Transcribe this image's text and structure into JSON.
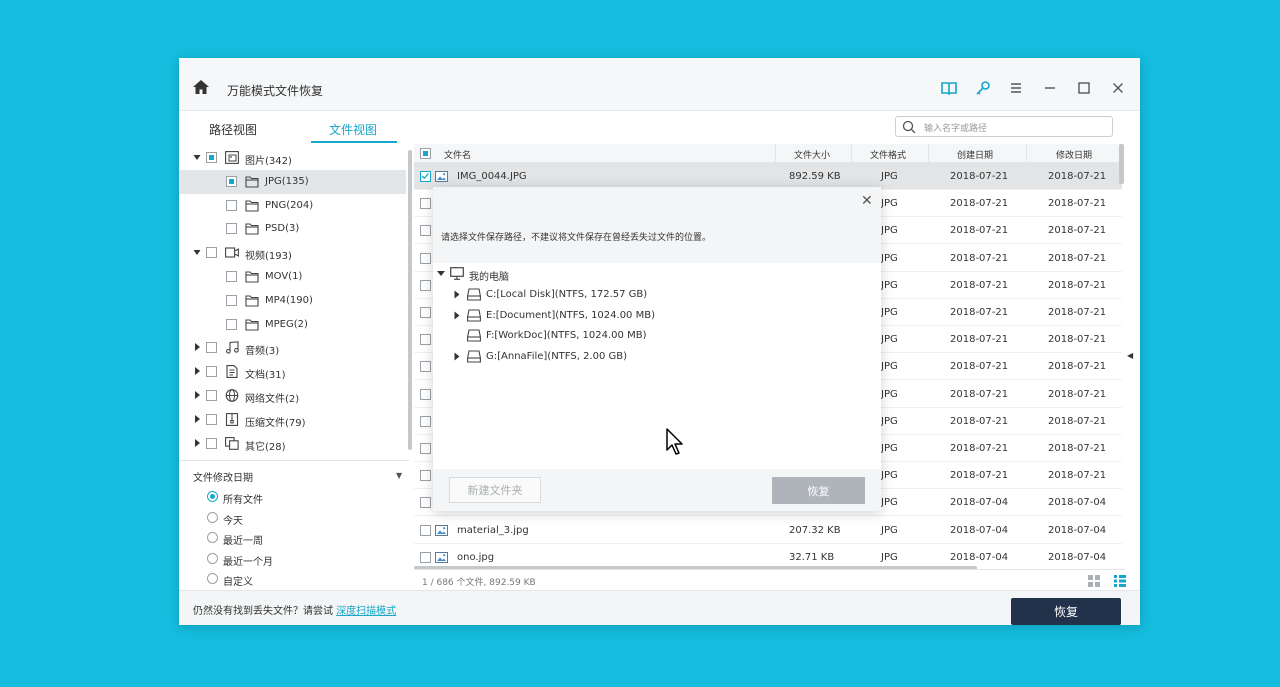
{
  "window": {
    "title": "万能模式文件恢复"
  },
  "tabs": [
    {
      "label": "路径视图",
      "active": false
    },
    {
      "label": "文件视图",
      "active": true
    }
  ],
  "search": {
    "placeholder": "输入名字或路径"
  },
  "tree": [
    {
      "label": "图片(342)",
      "icon": "image-folder-icon",
      "expanded": true,
      "check": "partial"
    },
    {
      "label": "JPG(135)",
      "icon": "folder-icon",
      "child": true,
      "check": "partial",
      "selected": true
    },
    {
      "label": "PNG(204)",
      "icon": "folder-icon",
      "child": true,
      "check": "none"
    },
    {
      "label": "PSD(3)",
      "icon": "folder-icon",
      "child": true,
      "check": "none"
    },
    {
      "label": "视频(193)",
      "icon": "video-folder-icon",
      "expanded": true,
      "check": "none"
    },
    {
      "label": "MOV(1)",
      "icon": "folder-icon",
      "child": true,
      "check": "none"
    },
    {
      "label": "MP4(190)",
      "icon": "folder-icon",
      "child": true,
      "check": "none"
    },
    {
      "label": "MPEG(2)",
      "icon": "folder-icon",
      "child": true,
      "check": "none"
    },
    {
      "label": "音频(3)",
      "icon": "music-icon",
      "expanded": false,
      "check": "none"
    },
    {
      "label": "文档(31)",
      "icon": "document-icon",
      "expanded": false,
      "check": "none"
    },
    {
      "label": "网络文件(2)",
      "icon": "globe-icon",
      "expanded": false,
      "check": "none"
    },
    {
      "label": "压缩文件(79)",
      "icon": "archive-icon",
      "expanded": false,
      "check": "none"
    },
    {
      "label": "其它(28)",
      "icon": "copy-icon",
      "expanded": false,
      "check": "none"
    }
  ],
  "filter": {
    "title": "文件修改日期",
    "options": [
      {
        "label": "所有文件",
        "selected": true
      },
      {
        "label": "今天",
        "selected": false
      },
      {
        "label": "最近一周",
        "selected": false
      },
      {
        "label": "最近一个月",
        "selected": false
      },
      {
        "label": "自定义",
        "selected": false
      }
    ]
  },
  "list": {
    "headers": {
      "name": "文件名",
      "size": "文件大小",
      "format": "文件格式",
      "created": "创建日期",
      "modified": "修改日期"
    },
    "rows": [
      {
        "name": "IMG_0044.JPG",
        "size": "892.59 KB",
        "format": "JPG",
        "created": "2018-07-21",
        "modified": "2018-07-21",
        "selected": true,
        "checked": true
      },
      {
        "name": "",
        "size": "",
        "format": "JPG",
        "created": "2018-07-21",
        "modified": "2018-07-21"
      },
      {
        "name": "",
        "size": "",
        "format": "JPG",
        "created": "2018-07-21",
        "modified": "2018-07-21"
      },
      {
        "name": "",
        "size": "",
        "format": "JPG",
        "created": "2018-07-21",
        "modified": "2018-07-21"
      },
      {
        "name": "",
        "size": "",
        "format": "JPG",
        "created": "2018-07-21",
        "modified": "2018-07-21"
      },
      {
        "name": "",
        "size": "",
        "format": "JPG",
        "created": "2018-07-21",
        "modified": "2018-07-21"
      },
      {
        "name": "",
        "size": "",
        "format": "JPG",
        "created": "2018-07-21",
        "modified": "2018-07-21"
      },
      {
        "name": "",
        "size": "",
        "format": "JPG",
        "created": "2018-07-21",
        "modified": "2018-07-21"
      },
      {
        "name": "",
        "size": "",
        "format": "JPG",
        "created": "2018-07-21",
        "modified": "2018-07-21"
      },
      {
        "name": "",
        "size": "",
        "format": "JPG",
        "created": "2018-07-21",
        "modified": "2018-07-21"
      },
      {
        "name": "",
        "size": "",
        "format": "JPG",
        "created": "2018-07-21",
        "modified": "2018-07-21"
      },
      {
        "name": "",
        "size": "",
        "format": "JPG",
        "created": "2018-07-21",
        "modified": "2018-07-21"
      },
      {
        "name": "",
        "size": "",
        "format": "JPG",
        "created": "2018-07-04",
        "modified": "2018-07-04"
      },
      {
        "name": "material_3.jpg",
        "size": "207.32 KB",
        "format": "JPG",
        "created": "2018-07-04",
        "modified": "2018-07-04"
      },
      {
        "name": "ono.jpg",
        "size": "32.71 KB",
        "format": "JPG",
        "created": "2018-07-04",
        "modified": "2018-07-04"
      }
    ]
  },
  "status": {
    "text": "1 / 686 个文件, 892.59 KB"
  },
  "footer": {
    "text": "仍然没有找到丢失文件？请尝试 ",
    "link": "深度扫描模式",
    "recover_label": "恢复"
  },
  "dialog": {
    "message": "请选择文件保存路径，不建议将文件保存在曾经丢失过文件的位置。",
    "root": "我的电脑",
    "drives": [
      {
        "label": "C:[Local Disk](NTFS, 172.57 GB)",
        "expandable": true
      },
      {
        "label": "E:[Document](NTFS, 1024.00 MB)",
        "expandable": true
      },
      {
        "label": "F:[WorkDoc](NTFS, 1024.00 MB)",
        "expandable": false
      },
      {
        "label": "G:[AnnaFile](NTFS, 2.00 GB)",
        "expandable": true
      }
    ],
    "new_folder_label": "新建文件夹",
    "recover_label": "恢复"
  },
  "colors": {
    "accent": "#16a7c9",
    "primary_button": "#22324a",
    "background": "#15bcdd"
  }
}
